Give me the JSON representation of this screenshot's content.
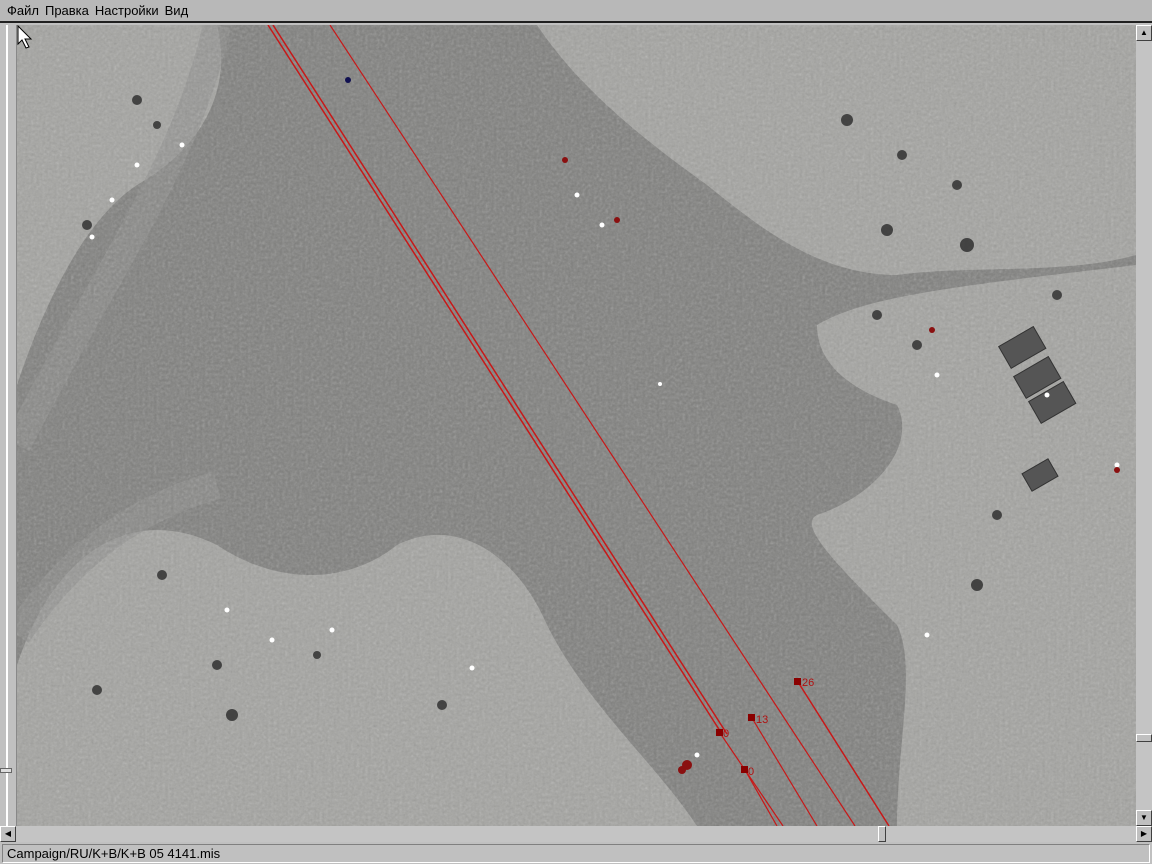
{
  "menu": {
    "items": [
      "Файл",
      "Правка",
      "Настройки",
      "Вид"
    ]
  },
  "map": {
    "waypoints": [
      {
        "label": "0"
      },
      {
        "label": "0"
      },
      {
        "label": "13"
      },
      {
        "label": "26"
      }
    ],
    "route_color": "#c81818"
  },
  "status": {
    "file_path": "Campaign/RU/K+B/K+B 05 4141.mis"
  }
}
